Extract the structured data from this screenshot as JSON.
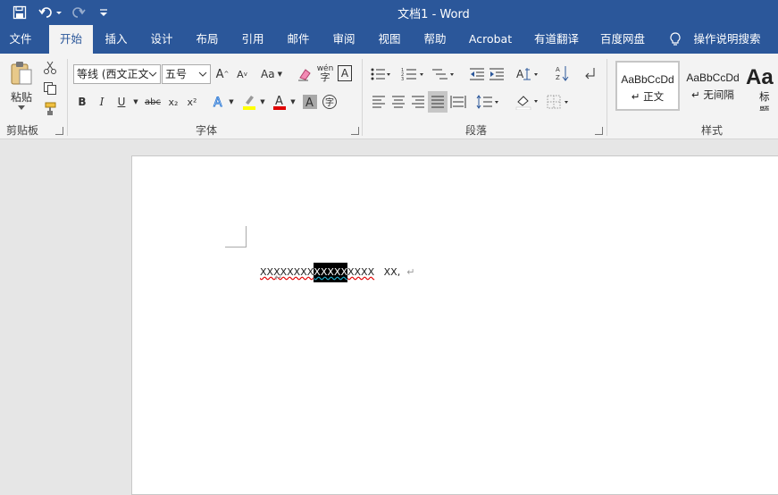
{
  "window": {
    "title": "文档1  -  Word"
  },
  "tabs": [
    {
      "label": "文件",
      "active": false
    },
    {
      "label": "开始",
      "active": true
    },
    {
      "label": "插入",
      "active": false
    },
    {
      "label": "设计",
      "active": false
    },
    {
      "label": "布局",
      "active": false
    },
    {
      "label": "引用",
      "active": false
    },
    {
      "label": "邮件",
      "active": false
    },
    {
      "label": "审阅",
      "active": false
    },
    {
      "label": "视图",
      "active": false
    },
    {
      "label": "帮助",
      "active": false
    },
    {
      "label": "Acrobat",
      "active": false
    },
    {
      "label": "有道翻译",
      "active": false
    },
    {
      "label": "百度网盘",
      "active": false
    }
  ],
  "tell_me": {
    "label": "操作说明搜索"
  },
  "clipboard": {
    "paste_label": "粘贴",
    "group_label": "剪贴板"
  },
  "font": {
    "name": "等线 (西文正文",
    "size": "五号",
    "group_label": "字体",
    "case_label": "Aa",
    "wen_label": "wén",
    "strike_label": "abc",
    "sub_label": "x₂",
    "sup_label": "x²",
    "char_border_label": "A",
    "grow_label": "A",
    "shrink_label": "A",
    "bold": "B",
    "italic": "I",
    "underline": "U",
    "phonetic_label": "字",
    "font_color": "#e00000",
    "highlight_color": "#ffff00"
  },
  "paragraph": {
    "group_label": "段落",
    "sort_label": "A Z"
  },
  "styles": {
    "group_label": "样式",
    "items": [
      {
        "preview": "AaBbCcDd",
        "name": "↵ 正文",
        "selected": true
      },
      {
        "preview": "AaBbCcDd",
        "name": "↵ 无间隔",
        "selected": false
      },
      {
        "preview": "Aa",
        "name": "标题",
        "selected": false
      }
    ]
  },
  "document": {
    "text_before": "XXXXXXXX",
    "text_selected": "XXXXX",
    "text_after": "XXXX",
    "text_tail": "XX,",
    "para_mark": "↵"
  },
  "colors": {
    "accent": "#2b579a",
    "ribbon_bg": "#f3f3f3"
  }
}
